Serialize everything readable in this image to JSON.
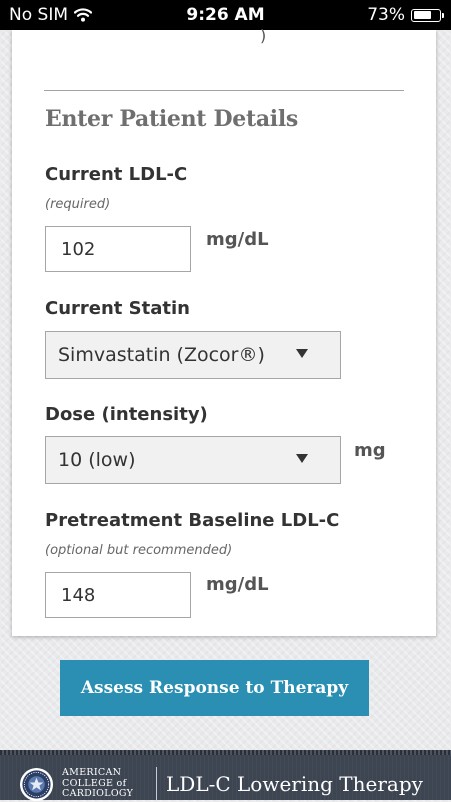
{
  "status_bar": {
    "carrier": "No SIM",
    "time": "9:26 AM",
    "battery_percent": "73%",
    "battery_level": 0.73,
    "wifi_icon": "wifi-icon",
    "battery_icon": "battery-icon"
  },
  "card": {
    "clipped_text": ")",
    "section_title": "Enter Patient Details",
    "ldl": {
      "label": "Current LDL-C",
      "hint": "(required)",
      "value": "102",
      "unit": "mg/dL"
    },
    "statin": {
      "label": "Current Statin",
      "selected": "Simvastatin (Zocor®)"
    },
    "dose": {
      "label": "Dose (intensity)",
      "selected": "10 (low)",
      "unit": "mg"
    },
    "baseline": {
      "label": "Pretreatment Baseline LDL-C",
      "hint": "(optional but recommended)",
      "value": "148",
      "unit": "mg/dL"
    }
  },
  "action": {
    "assess_label": "Assess Response to Therapy"
  },
  "footer": {
    "org_line1": "AMERICAN",
    "org_line2": "COLLEGE of",
    "org_line3": "CARDIOLOGY",
    "app_title": "LDL-C Lowering Therapy"
  },
  "colors": {
    "accent": "#2a8fb2",
    "footer_bg": "#3d4552",
    "section_title": "#6f6f6f"
  }
}
